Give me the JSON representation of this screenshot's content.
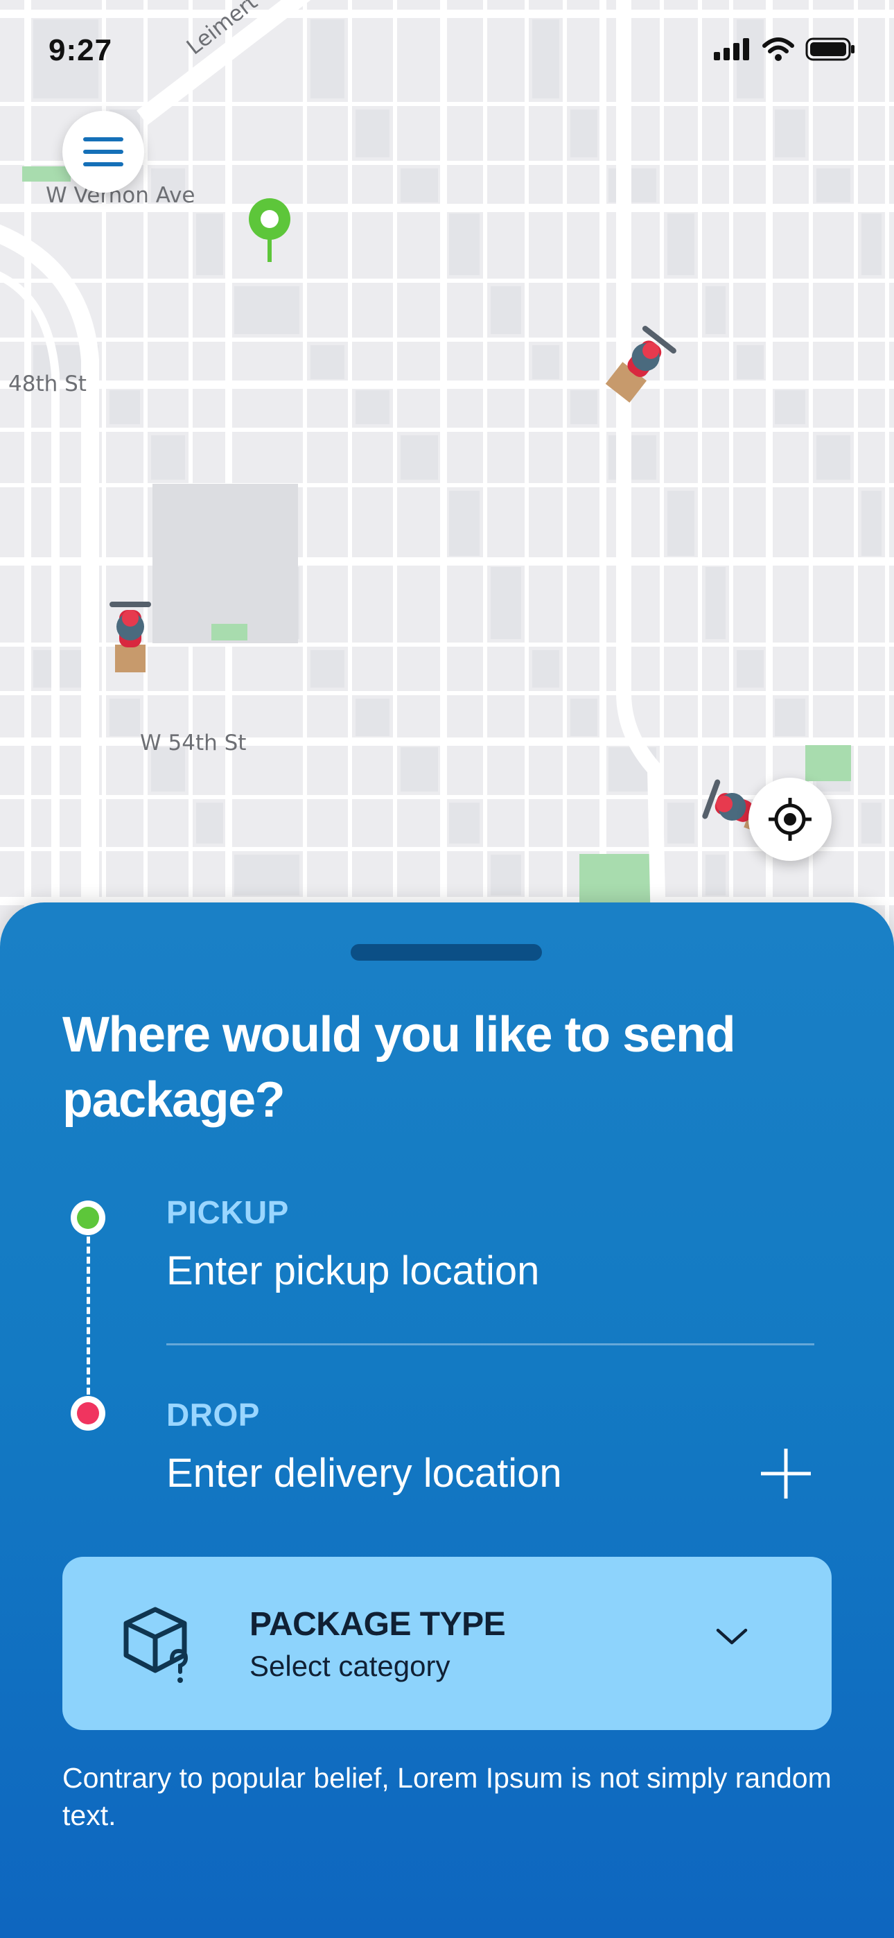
{
  "status_bar": {
    "time": "9:27"
  },
  "map": {
    "street_labels": [
      "Leimert",
      "W Vernon Ave",
      "48th St",
      "W 54th St"
    ]
  },
  "sheet": {
    "title": "Where would you like to send package?",
    "pickup": {
      "label": "PICKUP",
      "placeholder": "Enter pickup location"
    },
    "drop": {
      "label": "DROP",
      "placeholder": "Enter delivery location"
    },
    "package_type": {
      "title": "PACKAGE TYPE",
      "subtitle": "Select category"
    },
    "note": "Contrary to popular belief, Lorem Ipsum is not simply random text."
  },
  "colors": {
    "sheet_blue": "#137ac3",
    "pickup_green": "#5dc63a",
    "drop_red": "#f0345f",
    "card_blue": "#8dd3fc",
    "label_blue": "#9ad6ff"
  },
  "icons": [
    "signal-icon",
    "wifi-icon",
    "battery-icon",
    "hamburger-menu-icon",
    "location-pin-icon",
    "courier-scooter-icon",
    "crosshair-locate-icon",
    "plus-icon",
    "package-box-icon",
    "chevron-down-icon"
  ]
}
